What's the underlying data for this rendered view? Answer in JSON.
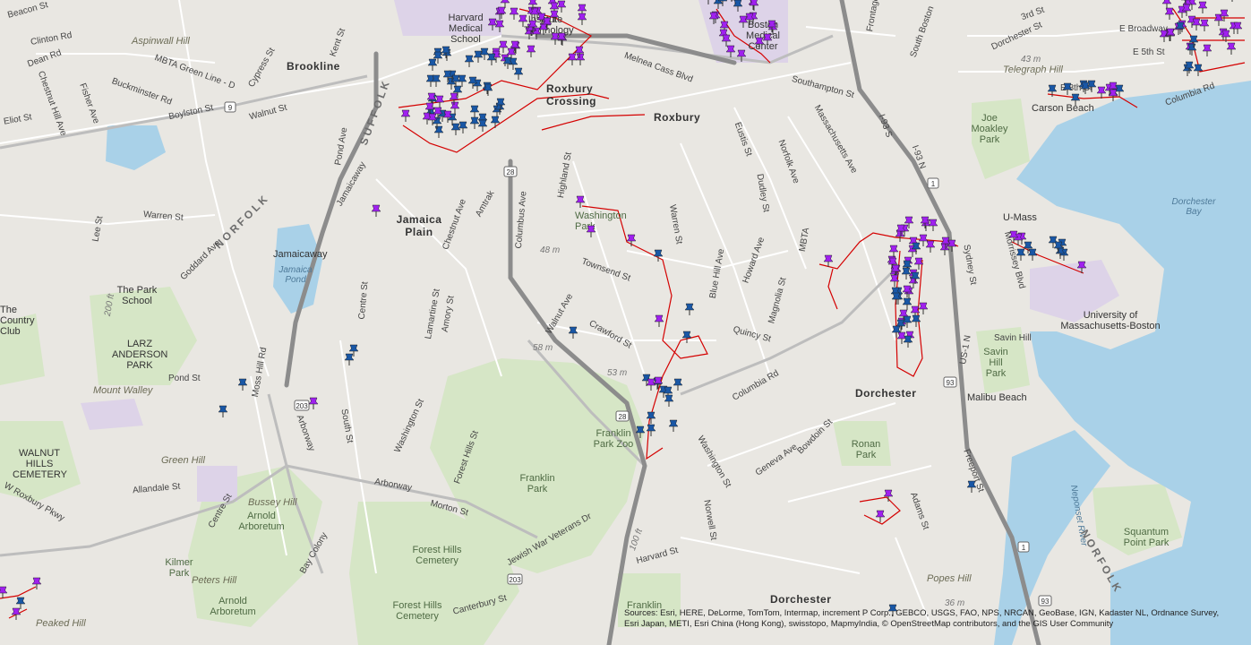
{
  "map": {
    "colors": {
      "land": "#e9e7e2",
      "park": "#d5e5c4",
      "water": "#a9d1e8",
      "highway": "#8c8c8c",
      "route": "#d40000",
      "pin_purple": "#a020f0",
      "pin_blue": "#1957a6"
    },
    "labels": {
      "beacon_st": "Beacon St",
      "clinton_rd": "Clinton Rd",
      "aspinwall_hill": "Aspinwall Hill",
      "dean_rd": "Dean Rd",
      "mbta_green": "MBTA Green Line - D",
      "cypress_st": "Cypress St",
      "kent_st": "Kent St",
      "brookline": "Brookline",
      "chestnut_hill_ave": "Chestnut Hill Ave",
      "buckminster_rd": "Buckminster Rd",
      "fisher_ave": "Fisher Ave",
      "eliot_st": "Eliot St",
      "boylston_st": "Boylston St",
      "walnut_st": "Walnut St",
      "suffolk": "SUFFOLK",
      "pond_ave": "Pond Ave",
      "jamaicaway": "Jamaicaway",
      "warren_st_w": "Warren St",
      "lee_st": "Lee St",
      "norfolk_w": "NORFOLK",
      "jamaicaway2": "Jamaicaway",
      "jamaica_pond": "Jamaica Pond",
      "goddard_ave": "Goddard Ave",
      "park_school": "The Park School",
      "country_club": "The Country Club",
      "larz_park": "LARZ ANDERSON PARK",
      "mount_walley": "Mount Walley",
      "pond_st": "Pond St",
      "moss_hill_rd": "Moss Hill Rd",
      "walnut_hills_cemetery": "WALNUT HILLS CEMETERY",
      "green_hill": "Green Hill",
      "allandale_st": "Allandale St",
      "w_roxbury_pkwy": "W Roxbury Pkwy",
      "bussey_hill": "Bussey Hill",
      "arnold_arboretum": "Arnold Arboretum",
      "centre_st": "Centre St",
      "kilmer_park": "Kilmer Park",
      "peters_hill": "Peters Hill",
      "arnold_arboretum2": "Arnold Arboretum",
      "peaked_hill": "Peaked Hill",
      "bay_colony": "Bay Colony",
      "arborway": "Arborway",
      "arborway2": "Arborway",
      "south_st": "South St",
      "washington_st_w": "Washington St",
      "forest_hills_st": "Forest Hills St",
      "morton_st": "Morton St",
      "forest_hills_cemetery": "Forest Hills Cemetery",
      "forest_hills_cemetery2": "Forest Hills Cemetery",
      "canterbury_st": "Canterbury St",
      "jewish_war_vets": "Jewish War Veterans Dr",
      "franklin_park": "Franklin Park",
      "franklin_park_zoo": "Franklin Park Zoo",
      "franklin_field": "Franklin",
      "harvard_medical_school": "Harvard Medical School",
      "institute_technology": "Institute Technology",
      "jamaica_plain": "Jamaica Plain",
      "chestnut_ave": "Chestnut Ave",
      "amory_st": "Amory St",
      "lamartine_st": "Lamartine St",
      "centre_st_jp": "Centre St",
      "columbus_ave": "Columbus Ave",
      "amtrak": "Amtrak",
      "roxbury_crossing": "Roxbury Crossing",
      "roxbury": "Roxbury",
      "melnea_cass": "Melnea Cass Blvd",
      "highland_st": "Highland St",
      "washington_park": "Washington Park",
      "warren_st": "Warren St",
      "townsend_st": "Townsend St",
      "walnut_ave": "Walnut Ave",
      "crawford_st": "Crawford St",
      "elev_48": "48 m",
      "elev_58": "58 m",
      "elev_53": "53 m",
      "blue_hill_ave": "Blue Hill Ave",
      "howard_ave": "Howard Ave",
      "quincy_st": "Quincy St",
      "columbia_rd": "Columbia Rd",
      "magnolia_st": "Magnolia St",
      "mbta_e": "MBTA",
      "norfolk_ave": "Norfolk Ave",
      "dudley_st": "Dudley St",
      "eustis_st": "Eustis St",
      "massachusetts_ave": "Massachusetts Ave",
      "southampton_st": "Southampton St",
      "boston_medical": "Boston Medical Center",
      "washington_st_e": "Washington St",
      "bowdoin_st": "Bowdoin St",
      "geneva_ave": "Geneva Ave",
      "norwell_st": "Norwell St",
      "harvard_st": "Harvard St",
      "dorchester": "Dorchester",
      "dorchester2": "Dorchester",
      "ronan_park": "Ronan Park",
      "freeport_st": "Freeport St",
      "adams_st": "Adams St",
      "popes_hill": "Popes Hill",
      "elev_36": "36 m",
      "i93_s": "I-93 S",
      "i93_n": "I-93 N",
      "us1": "US-1",
      "us1_n": "US-1 N",
      "sydney_st": "Sydney St",
      "morrissey_blvd": "Morrissey Blvd",
      "umass": "U-Mass",
      "umass_boston": "University of Massachusetts-Boston",
      "savin_hill": "Savin Hill",
      "savin_hill_park": "Savin Hill Park",
      "malibu_beach": "Malibu Beach",
      "dorchester_bay": "Dorchester Bay",
      "joe_moakley_park": "Joe Moakley Park",
      "carson_beach": "Carson Beach",
      "telegraph_hill": "Telegraph Hill",
      "elev_43": "43 m",
      "dorchester_st": "Dorchester St",
      "e_8th_st": "E 8th St",
      "e_5th_st": "E 5th St",
      "e_broadway": "E Broadway",
      "w_3rd_st": "3rd St",
      "columbia_rd_e": "Columbia Rd",
      "south_boston": "South Boston",
      "frontage": "Frontage",
      "neponset_river": "Neponset River",
      "norfolk_e": "NORFOLK",
      "squantum_point_park": "Squantum Point Park",
      "shield_9": "9",
      "shield_28": "28",
      "shield_28b": "28",
      "shield_203": "203",
      "shield_203b": "203",
      "shield_1": "1",
      "shield_93": "93",
      "shield_93b": "93",
      "shield_1b": "1",
      "elev_200": "200 ft",
      "elev_100": "100 ft"
    },
    "attribution": "Sources: Esri, HERE, DeLorme, TomTom, Intermap, increment P Corp., GEBCO, USGS, FAO, NPS, NRCAN, GeoBase, IGN, Kadaster NL, Ordnance Survey, Esri Japan, METI, Esri China (Hong Kong), swisstopo, MapmyIndia, © OpenStreetMap contributors, and the GIS User Community"
  }
}
